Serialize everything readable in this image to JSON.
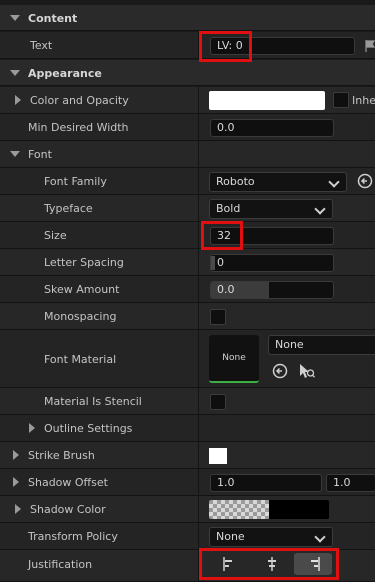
{
  "sections": {
    "content": "Content",
    "appearance": "Appearance",
    "font": "Font"
  },
  "labels": {
    "text": "Text",
    "color_and_opacity": "Color and Opacity",
    "min_desired_width": "Min Desired Width",
    "font_family": "Font Family",
    "typeface": "Typeface",
    "size": "Size",
    "letter_spacing": "Letter Spacing",
    "skew_amount": "Skew Amount",
    "monospacing": "Monospacing",
    "font_material": "Font Material",
    "material_is_stencil": "Material Is Stencil",
    "outline_settings": "Outline Settings",
    "strike_brush": "Strike Brush",
    "shadow_offset": "Shadow Offset",
    "shadow_color": "Shadow Color",
    "transform_policy": "Transform Policy",
    "justification": "Justification"
  },
  "values": {
    "text": "LV: 0",
    "color_overflow": "Inher",
    "min_desired_width": "0.0",
    "font_family": "Roboto",
    "typeface": "Bold",
    "size": "32",
    "letter_spacing": "0",
    "skew_amount": "0.0",
    "font_material_thumb": "None",
    "font_material_combo": "None",
    "shadow_offset_x": "1.0",
    "shadow_offset_y": "1.0",
    "transform_policy": "None"
  },
  "colors": {
    "highlight": "#e01010",
    "color_swatch": "#ffffff",
    "strike_swatch": "#ffffff",
    "accent_green": "#3cb043"
  },
  "icons": {
    "browse": "arrow-left-circle",
    "use_selected": "search-asset",
    "justify_left": "align-left",
    "justify_center": "align-center",
    "justify_right": "align-right"
  }
}
